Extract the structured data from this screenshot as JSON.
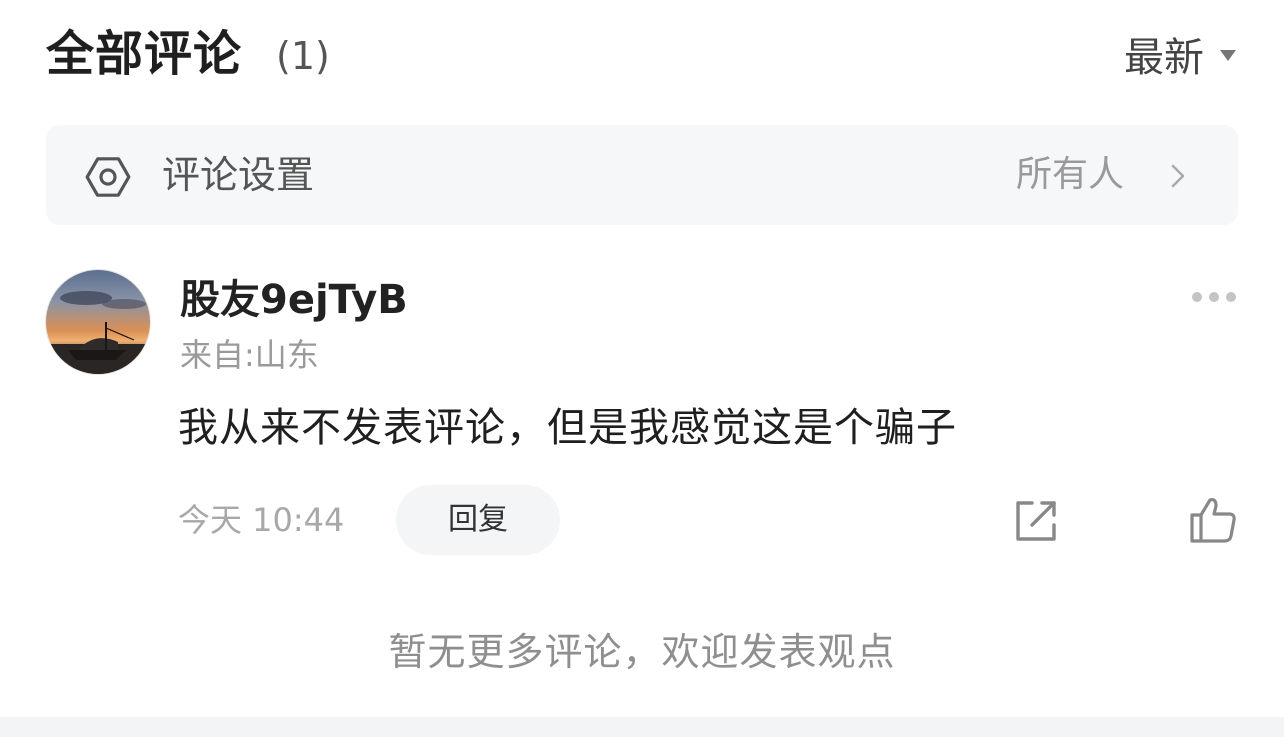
{
  "header": {
    "title": "全部评论",
    "count": "(1)",
    "sort_label": "最新"
  },
  "settings": {
    "icon": "gear-icon",
    "label": "评论设置",
    "value": "所有人"
  },
  "comment": {
    "username": "股友9ejTyB",
    "location": "来自:山东",
    "text": "我从来不发表评论，但是我感觉这是个骗子",
    "time": "今天 10:44",
    "reply_label": "回复"
  },
  "footer": {
    "no_more": "暂无更多评论，欢迎发表观点"
  }
}
